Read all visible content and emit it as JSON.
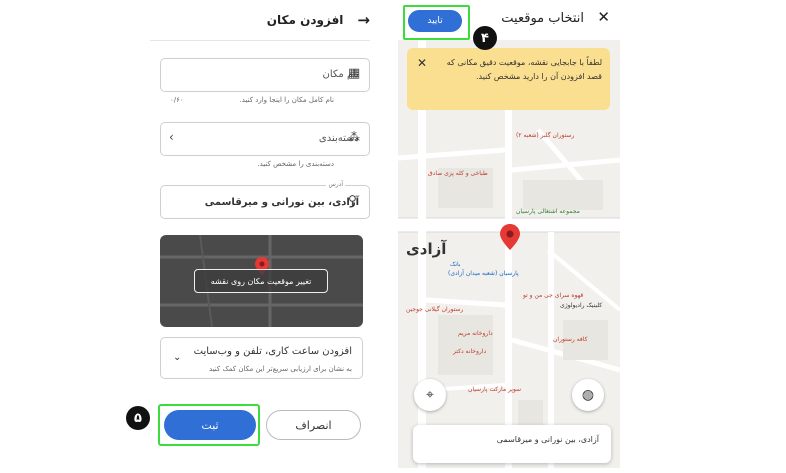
{
  "left_panel": {
    "header": {
      "title": "افزودن مکان",
      "back_icon": "arrow-right-icon"
    },
    "place_name": {
      "value": "نام مکان",
      "helper": "نام کامل مکان را اینجا وارد کنید.",
      "counter": "۰/۶۰",
      "icon": "storefront-icon"
    },
    "category": {
      "value": "دسته‌بندی",
      "helper": "دسته‌بندی را مشخص کنید.",
      "icon": "category-icon"
    },
    "address": {
      "label": "آدرس",
      "value": "آزادی، بین نورانی و میرقاسمی",
      "icon": "location-pin-icon"
    },
    "map_thumb": {
      "change_label": "تغییر موقعیت مکان روی نقشه"
    },
    "hours": {
      "title": "افزودن ساعت کاری، تلفن و وب‌سایت",
      "subtitle": "به نشان برای ارزیابی سریع‌تر این مکان کمک کنید"
    },
    "actions": {
      "submit": "ثبت",
      "cancel": "انصراف"
    },
    "badge": "۵"
  },
  "right_panel": {
    "header": {
      "title": "انتخاب موقعیت",
      "confirm": "تایید"
    },
    "badge": "۴",
    "notice": "لطفاً با جابجایی نقشه، موقعیت دقیق مکانی که قصد افزودن آن را دارید مشخص کنید.",
    "map": {
      "street_label": "آزادی",
      "pois": [
        "رستوران گلبر (شعبه ۲)",
        "طباخی و کله پزی صادق",
        "مجموعه اشتغالی پارسیان",
        "پارسیان (شعبه میدان آزادی)",
        "بانک",
        "قهوه سرای جی من و تو",
        "رستوران گیلانی جوجین",
        "کلینیک رادیولوژی",
        "داروخانه دکتر",
        "کافه رستوران",
        "داروخانه مریم",
        "سوپر مارکت پارسیان"
      ]
    },
    "address_card": "آزادی، بین نورانی و میرقاسمی"
  },
  "colors": {
    "primary": "#2f6fd6",
    "highlight": "#3ddc3d",
    "notice": "#fbdf90",
    "pin": "#e53935"
  }
}
